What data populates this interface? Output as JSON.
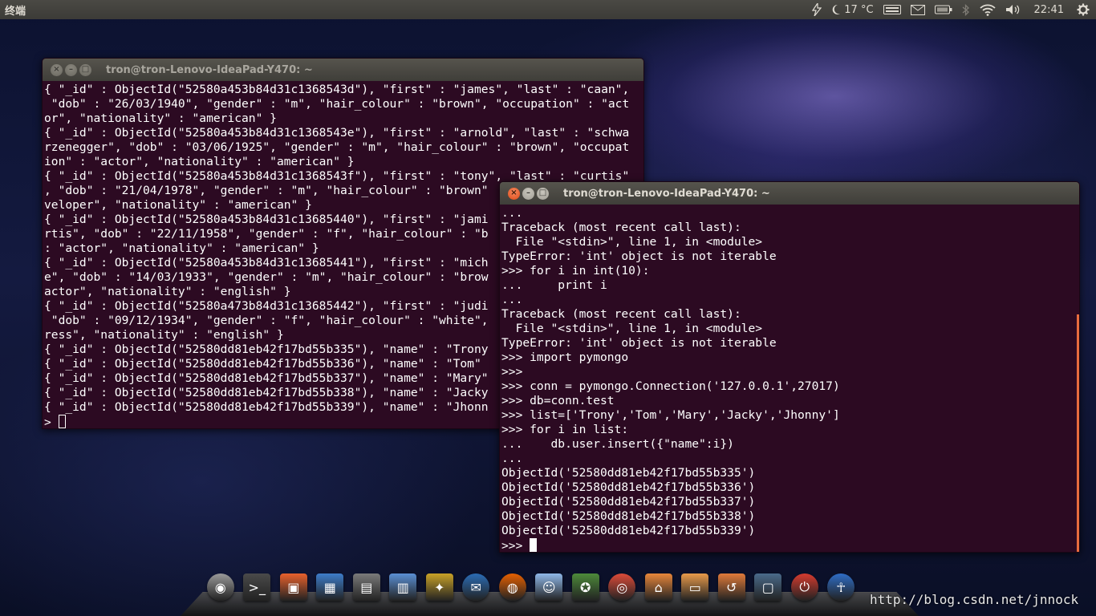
{
  "top_panel": {
    "app_title": "终端",
    "indicators": [
      {
        "icon": "lightning-icon",
        "name": "power-indicator"
      },
      {
        "icon": "moon-icon",
        "name": "weather-indicator"
      },
      {
        "icon": "keyboard-icon",
        "name": "keyboard-indicator"
      },
      {
        "icon": "mail-icon",
        "name": "messaging-indicator"
      },
      {
        "icon": "battery-icon",
        "name": "battery-indicator"
      },
      {
        "icon": "bluetooth-icon",
        "name": "bluetooth-indicator"
      },
      {
        "icon": "wifi-icon",
        "name": "network-indicator"
      },
      {
        "icon": "volume-icon",
        "name": "sound-indicator"
      },
      {
        "icon": "gear-icon",
        "name": "session-indicator"
      }
    ],
    "temperature": "17 °C",
    "clock": "22:41"
  },
  "window_back": {
    "title": "tron@tron-Lenovo-IdeaPad-Y470: ~",
    "lines": [
      "{ \"_id\" : ObjectId(\"52580a453b84d31c1368543d\"), \"first\" : \"james\", \"last\" : \"caan\",",
      " \"dob\" : \"26/03/1940\", \"gender\" : \"m\", \"hair_colour\" : \"brown\", \"occupation\" : \"act",
      "or\", \"nationality\" : \"american\" }",
      "{ \"_id\" : ObjectId(\"52580a453b84d31c1368543e\"), \"first\" : \"arnold\", \"last\" : \"schwa",
      "rzenegger\", \"dob\" : \"03/06/1925\", \"gender\" : \"m\", \"hair_colour\" : \"brown\", \"occupat",
      "ion\" : \"actor\", \"nationality\" : \"american\" }",
      "{ \"_id\" : ObjectId(\"52580a453b84d31c1368543f\"), \"first\" : \"tony\", \"last\" : \"curtis\"",
      ", \"dob\" : \"21/04/1978\", \"gender\" : \"m\", \"hair_colour\" : \"brown\"",
      "veloper\", \"nationality\" : \"american\" }",
      "{ \"_id\" : ObjectId(\"52580a453b84d31c13685440\"), \"first\" : \"jami",
      "rtis\", \"dob\" : \"22/11/1958\", \"gender\" : \"f\", \"hair_colour\" : \"b",
      ": \"actor\", \"nationality\" : \"american\" }",
      "{ \"_id\" : ObjectId(\"52580a453b84d31c13685441\"), \"first\" : \"mich",
      "e\", \"dob\" : \"14/03/1933\", \"gender\" : \"m\", \"hair_colour\" : \"brow",
      "actor\", \"nationality\" : \"english\" }",
      "{ \"_id\" : ObjectId(\"52580a473b84d31c13685442\"), \"first\" : \"judi",
      " \"dob\" : \"09/12/1934\", \"gender\" : \"f\", \"hair_colour\" : \"white\",",
      "ress\", \"nationality\" : \"english\" }",
      "{ \"_id\" : ObjectId(\"52580dd81eb42f17bd55b335\"), \"name\" : \"Trony",
      "{ \"_id\" : ObjectId(\"52580dd81eb42f17bd55b336\"), \"name\" : \"Tom\"",
      "{ \"_id\" : ObjectId(\"52580dd81eb42f17bd55b337\"), \"name\" : \"Mary\"",
      "{ \"_id\" : ObjectId(\"52580dd81eb42f17bd55b338\"), \"name\" : \"Jacky",
      "{ \"_id\" : ObjectId(\"52580dd81eb42f17bd55b339\"), \"name\" : \"Jhonn"
    ],
    "prompt": "> "
  },
  "window_front": {
    "title": "tron@tron-Lenovo-IdeaPad-Y470: ~",
    "lines": [
      "...",
      "Traceback (most recent call last):",
      "  File \"<stdin>\", line 1, in <module>",
      "TypeError: 'int' object is not iterable",
      ">>> for i in int(10):",
      "...     print i",
      "...",
      "Traceback (most recent call last):",
      "  File \"<stdin>\", line 1, in <module>",
      "TypeError: 'int' object is not iterable",
      ">>> import pymongo",
      ">>>",
      ">>> conn = pymongo.Connection('127.0.0.1',27017)",
      ">>> db=conn.test",
      ">>> list=['Trony','Tom','Mary','Jacky','Jhonny']",
      ">>> for i in list:",
      "...    db.user.insert({\"name\":i})",
      "...",
      "ObjectId('52580dd81eb42f17bd55b335')",
      "ObjectId('52580dd81eb42f17bd55b336')",
      "ObjectId('52580dd81eb42f17bd55b337')",
      "ObjectId('52580dd81eb42f17bd55b338')",
      "ObjectId('52580dd81eb42f17bd55b339')"
    ],
    "prompt": ">>> "
  },
  "dock": {
    "items": [
      {
        "name": "ubuntu-icon",
        "color": "#9a9a9a"
      },
      {
        "name": "terminal-icon",
        "color": "#4a4a4a"
      },
      {
        "name": "software-center-icon",
        "color": "#e8612c"
      },
      {
        "name": "image-viewer-icon",
        "color": "#3d7cc9"
      },
      {
        "name": "calculator-icon",
        "color": "#7a7a7a"
      },
      {
        "name": "document-viewer-icon",
        "color": "#5a8fd4"
      },
      {
        "name": "photos-icon",
        "color": "#c9a227"
      },
      {
        "name": "thunderbird-icon",
        "color": "#2b6cb5"
      },
      {
        "name": "firefox-icon",
        "color": "#e66000"
      },
      {
        "name": "chat-icon",
        "color": "#8fb8e8"
      },
      {
        "name": "maps-icon",
        "color": "#4d8a3a"
      },
      {
        "name": "chrome-icon",
        "color": "#dd4b39"
      },
      {
        "name": "home-folder-icon",
        "color": "#e8863a"
      },
      {
        "name": "files-icon",
        "color": "#e89a4a"
      },
      {
        "name": "backup-icon",
        "color": "#e07a3a"
      },
      {
        "name": "workspace-switcher-icon",
        "color": "#4a6a8a"
      },
      {
        "name": "shutdown-icon",
        "color": "#d63b2f"
      },
      {
        "name": "accessibility-icon",
        "color": "#2f6dc6"
      }
    ],
    "watermark": "http://blog.csdn.net/jnnock"
  }
}
